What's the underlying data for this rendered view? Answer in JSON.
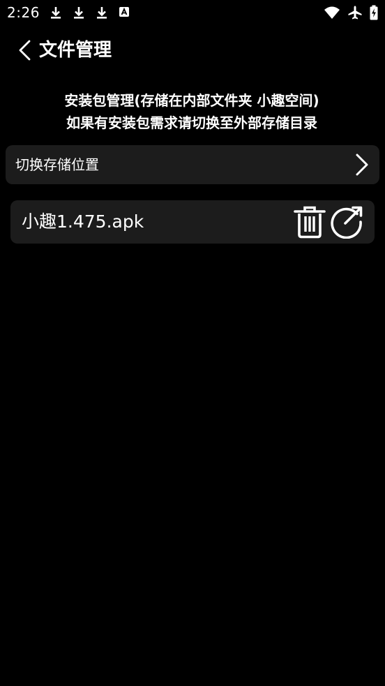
{
  "status_bar": {
    "time": "2:26",
    "left_icons": [
      "download-icon",
      "download-icon",
      "download-icon",
      "app-notification-icon"
    ],
    "right_icons": [
      "wifi-icon",
      "airplane-mode-icon",
      "battery-charging-icon"
    ]
  },
  "header": {
    "title": "文件管理",
    "back_icon": "chevron-left-icon"
  },
  "notice": {
    "line1": "安装包管理(存储在内部文件夹 小趣空间)",
    "line2": "如果有安装包需求请切换至外部存储目录"
  },
  "switch_storage": {
    "label": "切换存储位置",
    "icon": "chevron-right-icon"
  },
  "files": [
    {
      "name": "小趣1.475.apk",
      "actions": [
        "trash-icon",
        "open-external-icon"
      ]
    }
  ],
  "colors": {
    "background": "#000000",
    "card": "#1c1c1c",
    "text": "#ffffff"
  }
}
